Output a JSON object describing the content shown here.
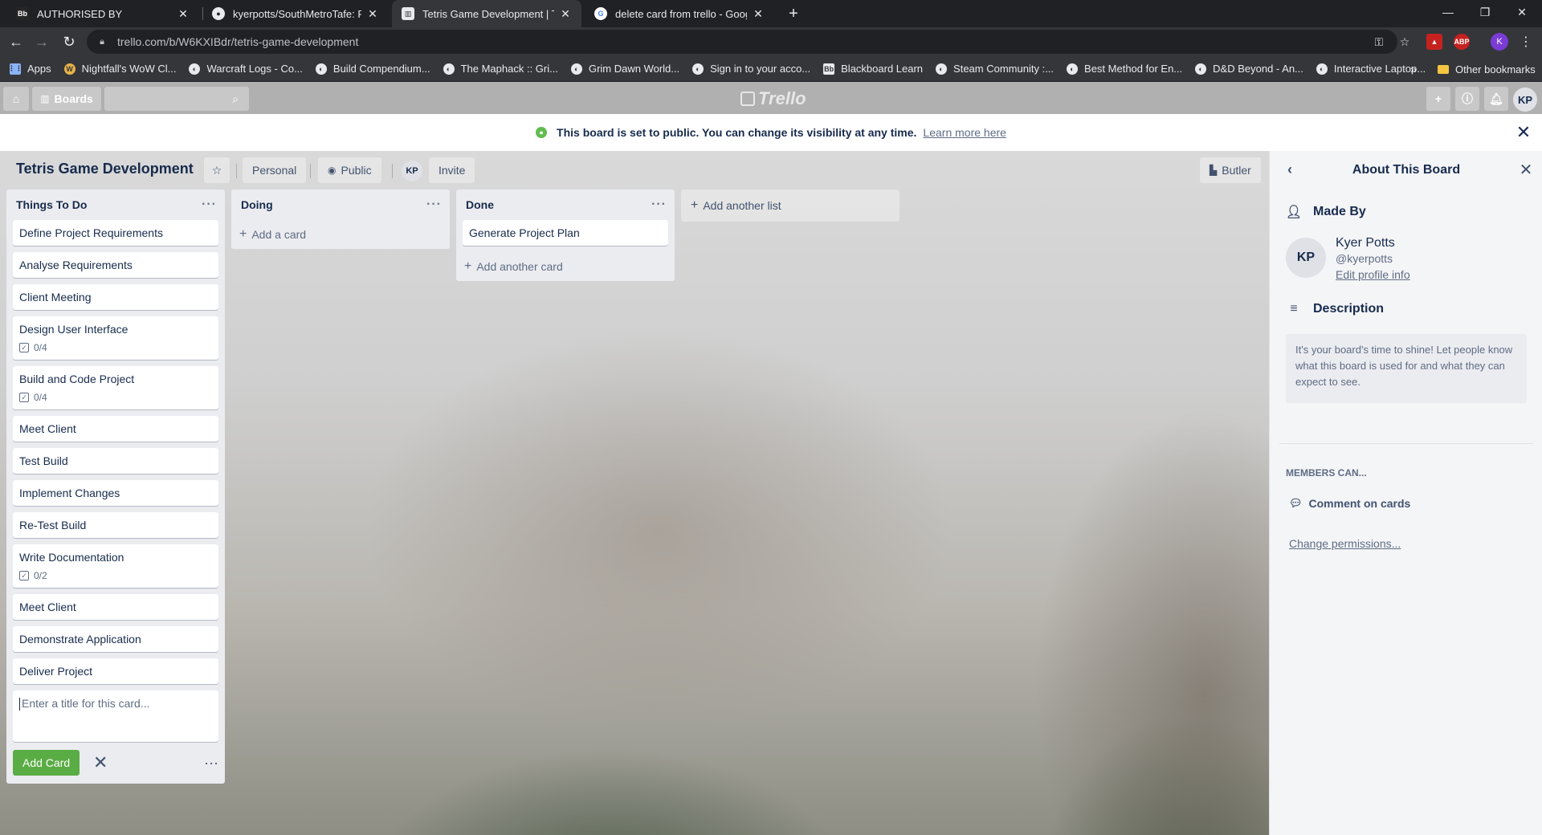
{
  "browser": {
    "tabs": [
      {
        "title": "AUTHORISED BY",
        "favicon": "Bb",
        "active": false
      },
      {
        "title": "kyerpotts/SouthMetroTafe: Repo",
        "favicon": "github-icon",
        "active": false
      },
      {
        "title": "Tetris Game Development | Trello",
        "favicon": "trello-icon",
        "active": true
      },
      {
        "title": "delete card from trello - Google",
        "favicon": "google-icon",
        "active": false
      }
    ],
    "url": "trello.com/b/W6KXIBdr/tetris-game-development",
    "profile_initial": "K",
    "bookmarks": [
      {
        "label": "Apps",
        "icon": "apps-grid-icon"
      },
      {
        "label": "Nightfall's WoW Cl...",
        "icon": "bookmark-favicon"
      },
      {
        "label": "Warcraft Logs - Co...",
        "icon": "bookmark-favicon"
      },
      {
        "label": "Build Compendium...",
        "icon": "bookmark-favicon"
      },
      {
        "label": "The Maphack :: Gri...",
        "icon": "bookmark-favicon"
      },
      {
        "label": "Grim Dawn World...",
        "icon": "bookmark-favicon"
      },
      {
        "label": "Sign in to your acco...",
        "icon": "bookmark-favicon"
      },
      {
        "label": "Blackboard Learn",
        "icon": "bookmark-favicon"
      },
      {
        "label": "Steam Community :...",
        "icon": "bookmark-favicon"
      },
      {
        "label": "Best Method for En...",
        "icon": "bookmark-favicon"
      },
      {
        "label": "D&D Beyond - An...",
        "icon": "bookmark-favicon"
      },
      {
        "label": "Interactive Laptop...",
        "icon": "bookmark-favicon"
      }
    ],
    "bookmarks_more": "»",
    "other_bookmarks": "Other bookmarks"
  },
  "header": {
    "boards_label": "Boards",
    "logo_text": "Trello",
    "avatar_initials": "KP"
  },
  "banner": {
    "message": "This board is set to public. You can change its visibility at any time.",
    "link": "Learn more here"
  },
  "board": {
    "title": "Tetris Game Development",
    "team_label": "Personal",
    "visibility_label": "Public",
    "member_initials": "KP",
    "invite_label": "Invite",
    "butler_label": "Butler"
  },
  "lists": [
    {
      "title": "Things To Do",
      "cards": [
        {
          "title": "Define Project Requirements"
        },
        {
          "title": "Analyse Requirements"
        },
        {
          "title": "Client Meeting"
        },
        {
          "title": "Design User Interface",
          "checklist": "0/4"
        },
        {
          "title": "Build and Code Project",
          "checklist": "0/4"
        },
        {
          "title": "Meet Client"
        },
        {
          "title": "Test Build"
        },
        {
          "title": "Implement Changes"
        },
        {
          "title": "Re-Test Build"
        },
        {
          "title": "Write Documentation",
          "checklist": "0/2"
        },
        {
          "title": "Meet Client"
        },
        {
          "title": "Demonstrate Application"
        },
        {
          "title": "Deliver Project"
        }
      ],
      "composer_placeholder": "Enter a title for this card...",
      "add_card_button": "Add Card"
    },
    {
      "title": "Doing",
      "cards": [],
      "add_card_label": "Add a card"
    },
    {
      "title": "Done",
      "cards": [
        {
          "title": "Generate Project Plan"
        }
      ],
      "add_card_label": "Add another card"
    }
  ],
  "add_list_label": "Add another list",
  "panel": {
    "title": "About This Board",
    "made_by_label": "Made By",
    "user_initials": "KP",
    "user_name": "Kyer Potts",
    "user_handle": "@kyerpotts",
    "edit_profile": "Edit profile info",
    "description_label": "Description",
    "description_text": "It's your board's time to shine! Let people know what this board is used for and what they can expect to see.",
    "members_can": "MEMBERS CAN...",
    "comment_on_cards": "Comment on cards",
    "change_permissions": "Change permissions..."
  },
  "colors": {
    "add_button": "#5aac44",
    "list_bg": "#ebecf0",
    "panel_bg": "#f4f5f7",
    "public_dot": "#61bd4f"
  }
}
